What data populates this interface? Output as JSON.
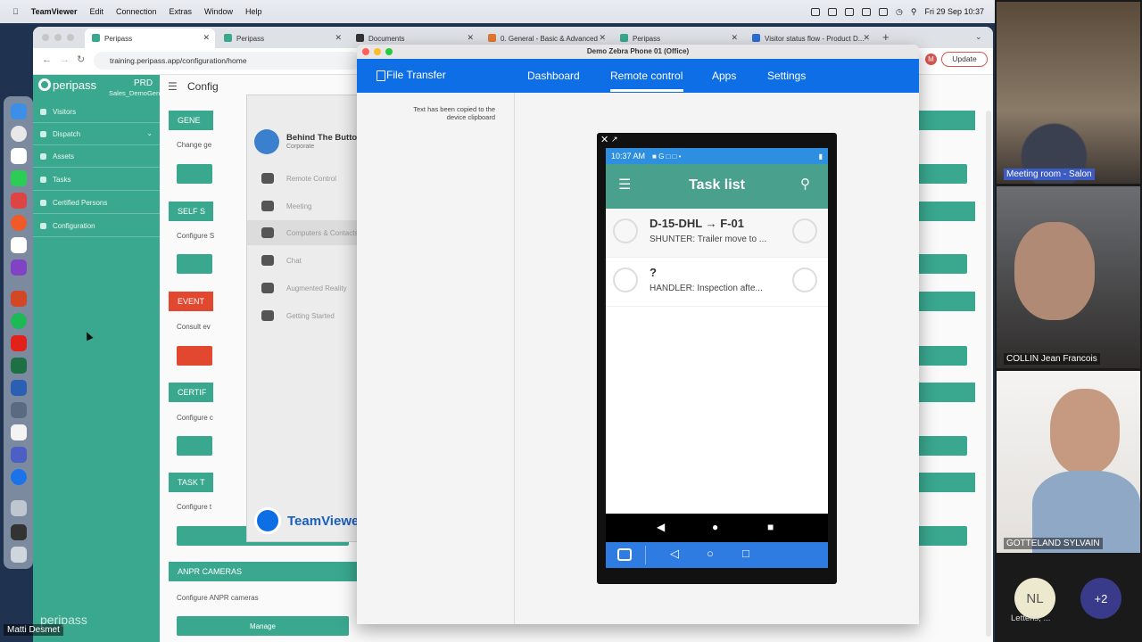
{
  "menubar": {
    "app": "TeamViewer",
    "items": [
      "Edit",
      "Connection",
      "Extras",
      "Window",
      "Help"
    ],
    "clock": "Fri 29 Sep  10:37"
  },
  "browser": {
    "tabs": [
      "Peripass",
      "Peripass",
      "Documents",
      "0. General - Basic & Advanced",
      "Peripass",
      "Visitor status flow - Product D..."
    ],
    "url": "training.peripass.app/configuration/home",
    "update_label": "Update",
    "profile_initial": "M"
  },
  "peripass": {
    "brand": "peripass",
    "env_badge": "PRD",
    "env_name": "Sales_DemoGent",
    "page_title": "Config",
    "sidebar": [
      "Visitors",
      "Dispatch",
      "Assets",
      "Tasks",
      "Certified Persons",
      "Configuration"
    ],
    "cards": [
      {
        "title": "GENE",
        "desc": "Change ge"
      },
      {
        "title": "SELF S",
        "desc": "Configure S"
      },
      {
        "title": "EVENT",
        "desc": "Consult ev"
      },
      {
        "title": "CERTIF",
        "desc": "Configure c"
      },
      {
        "title": "TASK T",
        "desc": "Configure t"
      },
      {
        "title": "ANPR CAMERAS",
        "desc": "Configure ANPR cameras"
      }
    ],
    "manage_label": "Manage",
    "footer_brand": "peripass"
  },
  "teamviewer_panel": {
    "account_name": "Behind The Buttons...",
    "account_type": "Corporate",
    "items": [
      "Remote Control",
      "Meeting",
      "Computers & Contacts",
      "Chat",
      "Augmented Reality",
      "Getting Started"
    ],
    "logo": "TeamViewer"
  },
  "remote_window": {
    "title": "Demo Zebra Phone 01 (Office)",
    "file_transfer": "File Transfer",
    "nav": [
      "Dashboard",
      "Remote control",
      "Apps",
      "Settings"
    ],
    "active_nav": "Remote control",
    "clipboard_msg_line1": "Text has been copied to the",
    "clipboard_msg_line2": "device clipboard"
  },
  "phone": {
    "time": "10:37 AM",
    "app_title": "Task list",
    "tasks": [
      {
        "title": "D-15-DHL → F-01",
        "subtitle": "SHUNTER: Trailer move to ..."
      },
      {
        "title": "?",
        "subtitle": "HANDLER: Inspection afte..."
      }
    ]
  },
  "meeting": {
    "participants": [
      "Meeting room - Salon",
      "COLLIN Jean Francois",
      "GOTTELAND SYLVAIN"
    ],
    "avatar_initials": "NL",
    "avatar_name": "Lettens, ...",
    "more_count": "+2",
    "self_name": "Matti Desmet"
  },
  "colors": {
    "peripass_green": "#3aa88f",
    "event_red": "#e2482f",
    "teamviewer_blue": "#0e6ee5"
  }
}
